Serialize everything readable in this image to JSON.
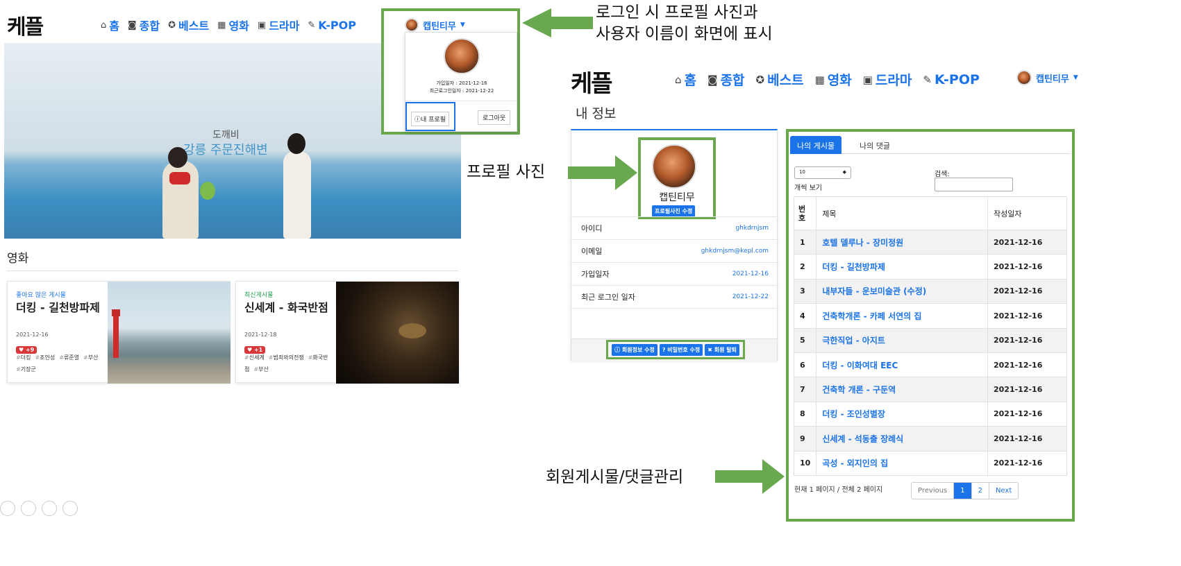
{
  "left": {
    "logo": "케플",
    "nav": [
      {
        "icon": "home-icon",
        "glyph": "⌂",
        "label": "홈"
      },
      {
        "icon": "camera-icon",
        "glyph": "◙",
        "label": "종합"
      },
      {
        "icon": "award-icon",
        "glyph": "✪",
        "label": "베스트"
      },
      {
        "icon": "film-icon",
        "glyph": "▦",
        "label": "영화"
      },
      {
        "icon": "tv-icon",
        "glyph": "▣",
        "label": "드라마"
      },
      {
        "icon": "mic-icon",
        "glyph": "✎",
        "label": "K-POP"
      }
    ],
    "hero": {
      "line1": "도깨비",
      "line2": "강릉 주문진해변"
    },
    "section_title": "영화",
    "cards": [
      {
        "badge": "좋아요 많은 게시물",
        "title": "더킹 - 길천방파제",
        "date": "2021-12-16",
        "likes": "+9",
        "tags": [
          "더킹",
          "조인성",
          "류준열",
          "부산",
          "기장군"
        ],
        "badge_color": "#1a73e8"
      },
      {
        "badge": "최신게시물",
        "title": "신세계 - 화국반점",
        "date": "2021-12-18",
        "likes": "+1",
        "tags": [
          "신세계",
          "범죄와의전쟁",
          "화국반점",
          "부산"
        ],
        "badge_color": "#1e9e4a"
      }
    ]
  },
  "dropdown": {
    "username": "캡틴티무",
    "join_label": "가입일자 : 2021-12-16",
    "last_login_label": "최근로그인일자 : 2021-12-22",
    "profile_button": "내 프로필",
    "logout_button": "로그아웃"
  },
  "right": {
    "logo": "케플",
    "nav": [
      {
        "icon": "home-icon",
        "glyph": "⌂",
        "label": "홈"
      },
      {
        "icon": "camera-icon",
        "glyph": "◙",
        "label": "종합"
      },
      {
        "icon": "award-icon",
        "glyph": "✪",
        "label": "베스트"
      },
      {
        "icon": "film-icon",
        "glyph": "▦",
        "label": "영화"
      },
      {
        "icon": "tv-icon",
        "glyph": "▣",
        "label": "드라마"
      },
      {
        "icon": "mic-icon",
        "glyph": "✎",
        "label": "K-POP"
      }
    ],
    "username": "캡틴티무",
    "page_title": "내 정보",
    "profile": {
      "name": "캡틴티무",
      "photo_button": "프로필사진 수정",
      "rows": [
        {
          "label": "아이디",
          "value": "ghkdrnjsm"
        },
        {
          "label": "이메일",
          "value": "ghkdrnjsm@kepl.com"
        },
        {
          "label": "가입일자",
          "value": "2021-12-16"
        },
        {
          "label": "최근 로그인 일자",
          "value": "2021-12-22"
        }
      ],
      "buttons": [
        "회원정보 수정",
        "비밀번호 수정",
        "회원 탈퇴"
      ]
    },
    "tabs": [
      "나의 게시물",
      "나의 댓글"
    ],
    "page_size": "10",
    "page_size_label": "개씩 보기",
    "search_label": "검색:",
    "columns": [
      "번호",
      "제목",
      "작성일자"
    ],
    "rows": [
      {
        "num": "1",
        "title": "호텔 델루나 - 장미정원",
        "date": "2021-12-16"
      },
      {
        "num": "2",
        "title": "더킹 - 길천방파제",
        "date": "2021-12-16"
      },
      {
        "num": "3",
        "title": "내부자들 - 운보미술관 (수정)",
        "date": "2021-12-16"
      },
      {
        "num": "4",
        "title": "건축학개론 - 카페 서연의 집",
        "date": "2021-12-16"
      },
      {
        "num": "5",
        "title": "극한직업 - 아지트",
        "date": "2021-12-16"
      },
      {
        "num": "6",
        "title": "더킹 - 이화여대 EEC",
        "date": "2021-12-16"
      },
      {
        "num": "7",
        "title": "건축학 개론 - 구둔역",
        "date": "2021-12-16"
      },
      {
        "num": "8",
        "title": "더킹 - 조인성별장",
        "date": "2021-12-16"
      },
      {
        "num": "9",
        "title": "신세계 - 석동출 장례식",
        "date": "2021-12-16"
      },
      {
        "num": "10",
        "title": "곡성 - 외지인의 집",
        "date": "2021-12-16"
      }
    ],
    "page_info": "현재 1 페이지 / 전체 2 페이지",
    "pagination": [
      "Previous",
      "1",
      "2",
      "Next"
    ]
  },
  "annotations": {
    "login": [
      "로그인 시 프로필 사진과",
      "사용자 이름이 화면에 표시"
    ],
    "photo": "프로필 사진",
    "posts": "회원게시물/댓글관리"
  },
  "colors": {
    "accent": "#1a73e8",
    "highlight": "#6aa84f",
    "like": "#d9383a"
  }
}
